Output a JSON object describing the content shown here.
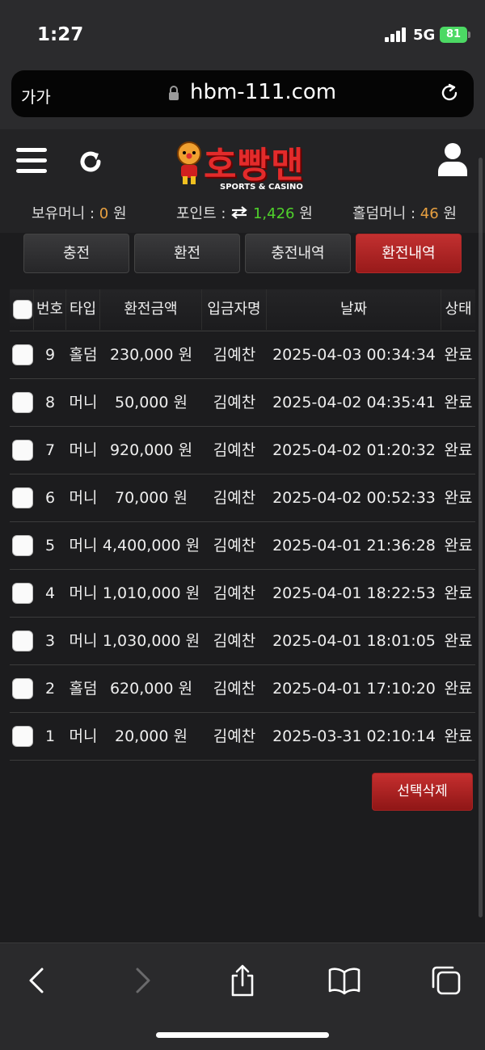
{
  "status_bar": {
    "time": "1:27",
    "network": "5G",
    "battery": "81"
  },
  "browser": {
    "text_size_label": "가가",
    "url": "hbm-111.com"
  },
  "header": {
    "logo_text": "호빵맨",
    "logo_subtitle": "SPORTS & CASINO",
    "balances": {
      "money_label": "보유머니 :",
      "money_value": "0",
      "money_unit": "원",
      "point_label": "포인트 :",
      "point_value": "1,426",
      "point_unit": "원",
      "holdem_label": "홀덤머니 :",
      "holdem_value": "46",
      "holdem_unit": "원"
    }
  },
  "tabs": [
    {
      "label": "충전",
      "active": false
    },
    {
      "label": "환전",
      "active": false
    },
    {
      "label": "충전내역",
      "active": false
    },
    {
      "label": "환전내역",
      "active": true
    }
  ],
  "table": {
    "headers": [
      "번호",
      "타입",
      "환전금액",
      "입금자명",
      "날짜",
      "상태"
    ],
    "rows": [
      {
        "no": "9",
        "type": "홀덤",
        "amount": "230,000 원",
        "name": "김예찬",
        "date": "2025-04-03 00:34:34",
        "status": "완료"
      },
      {
        "no": "8",
        "type": "머니",
        "amount": "50,000 원",
        "name": "김예찬",
        "date": "2025-04-02 04:35:41",
        "status": "완료"
      },
      {
        "no": "7",
        "type": "머니",
        "amount": "920,000 원",
        "name": "김예찬",
        "date": "2025-04-02 01:20:32",
        "status": "완료"
      },
      {
        "no": "6",
        "type": "머니",
        "amount": "70,000 원",
        "name": "김예찬",
        "date": "2025-04-02 00:52:33",
        "status": "완료"
      },
      {
        "no": "5",
        "type": "머니",
        "amount": "4,400,000 원",
        "name": "김예찬",
        "date": "2025-04-01 21:36:28",
        "status": "완료"
      },
      {
        "no": "4",
        "type": "머니",
        "amount": "1,010,000 원",
        "name": "김예찬",
        "date": "2025-04-01 18:22:53",
        "status": "완료"
      },
      {
        "no": "3",
        "type": "머니",
        "amount": "1,030,000 원",
        "name": "김예찬",
        "date": "2025-04-01 18:01:05",
        "status": "완료"
      },
      {
        "no": "2",
        "type": "홀덤",
        "amount": "620,000 원",
        "name": "김예찬",
        "date": "2025-04-01 17:10:20",
        "status": "완료"
      },
      {
        "no": "1",
        "type": "머니",
        "amount": "20,000 원",
        "name": "김예찬",
        "date": "2025-03-31 02:10:14",
        "status": "완료"
      }
    ]
  },
  "actions": {
    "delete_selected": "선택삭제"
  },
  "colors": {
    "accent_red": "#c23030",
    "point_green": "#4fd12b",
    "value_orange": "#e8a040",
    "background": "#1c1c1e"
  },
  "icons": [
    "menu-icon",
    "refresh-icon",
    "user-icon",
    "lock-icon",
    "reload-icon",
    "back-icon",
    "forward-icon",
    "share-icon",
    "bookmarks-icon",
    "tabs-icon"
  ]
}
